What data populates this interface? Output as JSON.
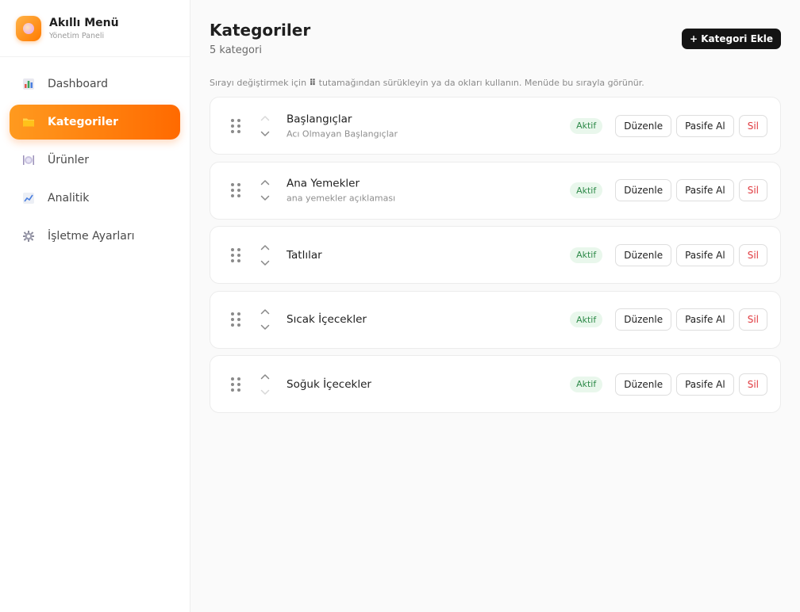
{
  "brand": {
    "title": "Akıllı Menü",
    "subtitle": "Yönetim Paneli"
  },
  "sidebar": {
    "items": [
      {
        "label": "Dashboard",
        "icon": "bar-chart-icon",
        "active": false
      },
      {
        "label": "Kategoriler",
        "icon": "folder-icon",
        "active": true
      },
      {
        "label": "Ürünler",
        "icon": "plate-icon",
        "active": false
      },
      {
        "label": "Analitik",
        "icon": "line-chart-icon",
        "active": false
      },
      {
        "label": "İşletme Ayarları",
        "icon": "gear-icon",
        "active": false
      }
    ]
  },
  "header": {
    "title": "Kategoriler",
    "count": "5 kategori",
    "add_label": "+ Kategori Ekle"
  },
  "hint": {
    "before": "Sırayı değiştirmek için",
    "grip": "⠿",
    "after": "tutamağından sürükleyin ya da okları kullanın. Menüde bu sırayla görünür."
  },
  "actions": {
    "badge": "Aktif",
    "edit": "Düzenle",
    "deactivate": "Pasife Al",
    "delete": "Sil"
  },
  "categories": [
    {
      "name": "Başlangıçlar",
      "description": "Acı Olmayan Başlangıçlar",
      "status": "Aktif",
      "up_disabled": true,
      "down_disabled": false
    },
    {
      "name": "Ana Yemekler",
      "description": "ana yemekler açıklaması",
      "status": "Aktif",
      "up_disabled": false,
      "down_disabled": false
    },
    {
      "name": "Tatlılar",
      "description": "",
      "status": "Aktif",
      "up_disabled": false,
      "down_disabled": false
    },
    {
      "name": "Sıcak İçecekler",
      "description": "",
      "status": "Aktif",
      "up_disabled": false,
      "down_disabled": false
    },
    {
      "name": "Soğuk İçecekler",
      "description": "",
      "status": "Aktif",
      "up_disabled": false,
      "down_disabled": true
    }
  ],
  "colors": {
    "accent": "#ff7a00",
    "active_badge_bg": "#e9f7ec",
    "active_badge_text": "#2e8a49",
    "delete_text": "#e0393e",
    "primary_button": "#141414"
  }
}
